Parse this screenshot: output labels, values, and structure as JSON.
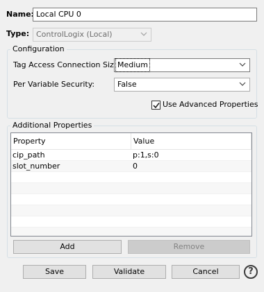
{
  "name_label": "Name:",
  "name_value": "Local CPU 0",
  "type_label": "Type:",
  "type_value": "ControlLogix (Local)",
  "configuration": {
    "title": "Configuration",
    "tag_access_label": "Tag Access Connection Size:",
    "tag_access_value": "Medium",
    "per_var_label": "Per Variable Security:",
    "per_var_value": "False",
    "use_advanced_label": "Use Advanced Properties",
    "use_advanced_checked": true
  },
  "additional": {
    "title": "Additional Properties",
    "columns": [
      "Property",
      "Value"
    ],
    "rows": [
      {
        "property": "cip_path",
        "value": "p:1,s:0"
      },
      {
        "property": "slot_number",
        "value": "0"
      }
    ],
    "add_label": "Add",
    "remove_label": "Remove"
  },
  "footer": {
    "save_label": "Save",
    "validate_label": "Validate",
    "cancel_label": "Cancel",
    "help_glyph": "?"
  },
  "icons": {
    "chevron": "chevron-down-icon",
    "check": "checkmark-icon",
    "help": "help-icon"
  }
}
